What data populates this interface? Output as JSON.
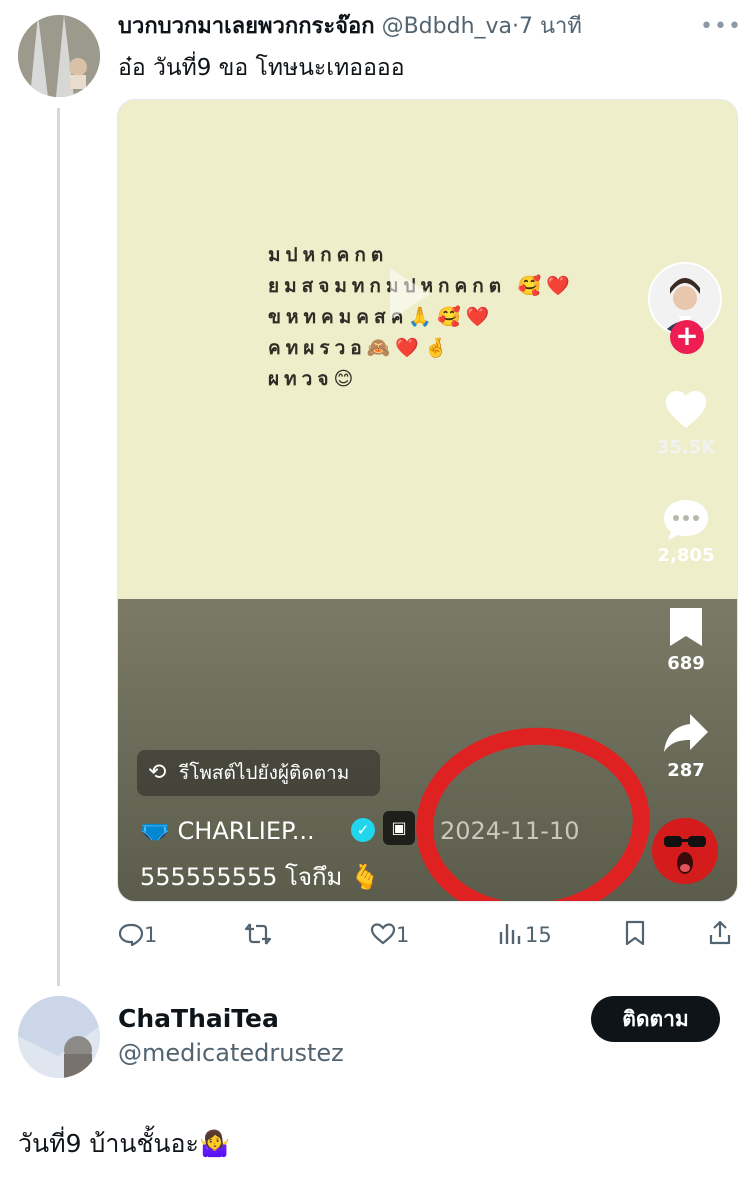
{
  "tweet": {
    "author_name": "บวกบวกมาเลยพวกกระจ๊อก",
    "handle": "@Bdbdh_va",
    "separator": "·",
    "time": "7 นาที",
    "more": "•••",
    "text": "อ๋อ วันที่9 ขอ โทษนะเทออออ"
  },
  "media": {
    "note_text": "มปหกคกต\nยมสจมทกมปหกคกต 🥰❤️\nขหทคมคสค🙏🥰❤️\nคทผรวอ🙈❤️🤞\nผทวจ😊",
    "likes": "35.5K",
    "comments": "2,805",
    "saves": "689",
    "shares": "287",
    "repost_label": "รีโพสต์ไปยังผู้ติดตาม",
    "author": "🩲 CHARLIEP...",
    "date": "2024-11-10",
    "caption": "555555555  โจกึม 🫰"
  },
  "actions": {
    "replies": "1",
    "reposts": "",
    "likes": "1",
    "views": "15"
  },
  "reply": {
    "name": "ChaThaiTea",
    "handle": "@medicatedrustez",
    "follow_label": "ติดตาม",
    "text": "วันที่9 บ้านชั้นอะ🤷‍♀️"
  },
  "colors": {
    "accent_red": "#e61f1f",
    "tiktok_pink": "#ee1d52",
    "note_bg": "#eeeeca",
    "verified": "#20d5ec"
  }
}
